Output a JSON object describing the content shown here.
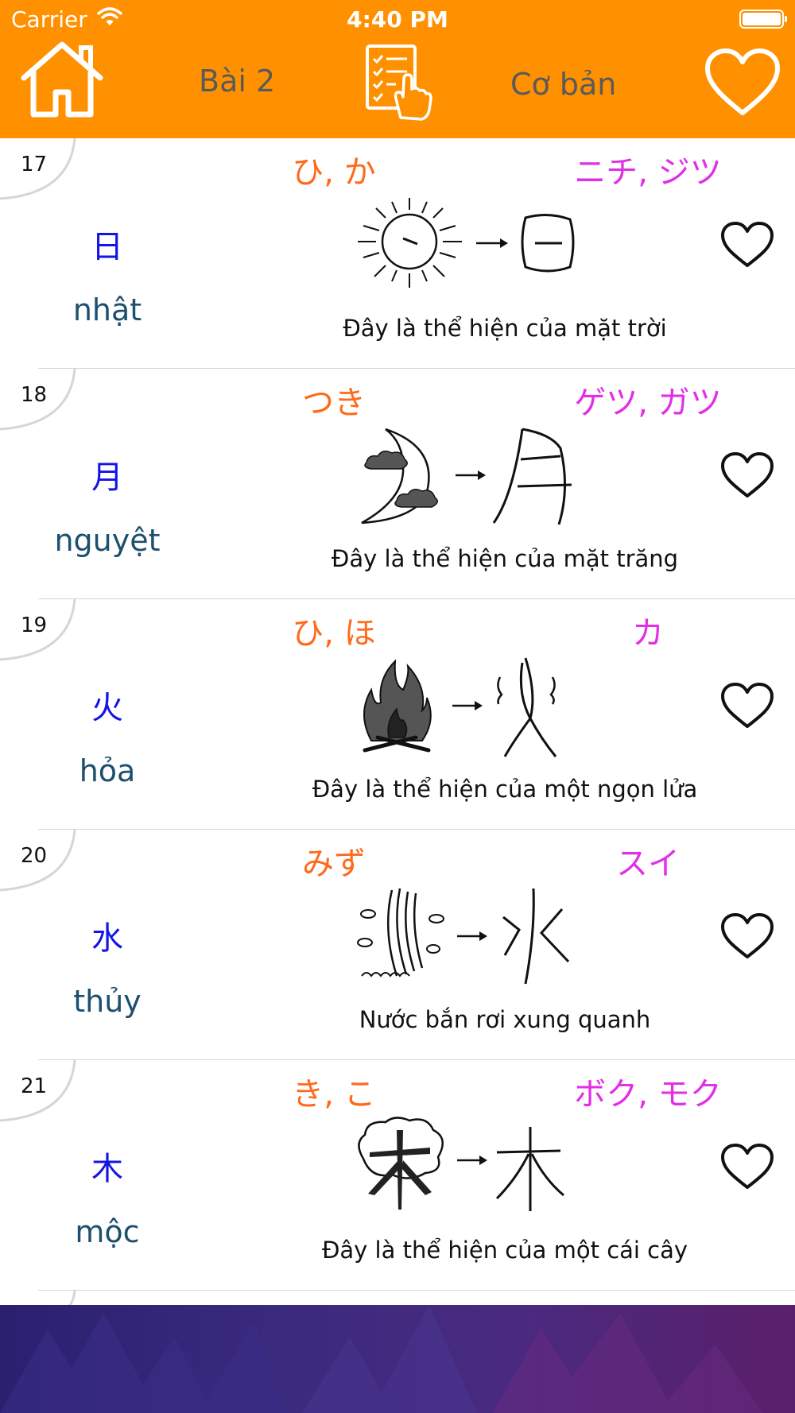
{
  "status_bar": {
    "carrier": "Carrier",
    "time": "4:40 PM"
  },
  "nav": {
    "lesson": "Bài 2",
    "level": "Cơ bản"
  },
  "colors": {
    "accent": "#ff9000",
    "kun_reading": "#ff6a1a",
    "on_reading": "#e22ee6",
    "kanji": "#1414e6",
    "sino_vietnamese": "#1d4f6e"
  },
  "icons": {
    "home": "home-icon",
    "test": "checklist-tap-icon",
    "favorite": "heart-outline-icon"
  },
  "items": [
    {
      "number": "17",
      "kun": "ひ, か",
      "on": "ニチ, ジツ",
      "kanji": "日",
      "sino": "nhật",
      "description": "Đây là thể hiện của mặt trời",
      "picture": "sun-to-kanji-illustration"
    },
    {
      "number": "18",
      "kun": "つき",
      "on": "ゲツ, ガツ",
      "kanji": "月",
      "sino": "nguyệt",
      "description": "Đây là thể hiện của  mặt trăng",
      "picture": "moon-to-kanji-illustration"
    },
    {
      "number": "19",
      "kun": "ひ, ほ",
      "on": "カ",
      "kanji": "火",
      "sino": "hỏa",
      "description": "Đây là thể hiện của một ngọn lửa",
      "picture": "fire-to-kanji-illustration"
    },
    {
      "number": "20",
      "kun": "みず",
      "on": "スイ",
      "kanji": "水",
      "sino": "thủy",
      "description": "Nước bắn rơi xung quanh",
      "picture": "water-to-kanji-illustration"
    },
    {
      "number": "21",
      "kun": "き, こ",
      "on": "ボク, モク",
      "kanji": "木",
      "sino": "mộc",
      "description": "Đây là thể hiện của một cái cây",
      "picture": "tree-to-kanji-illustration"
    }
  ]
}
